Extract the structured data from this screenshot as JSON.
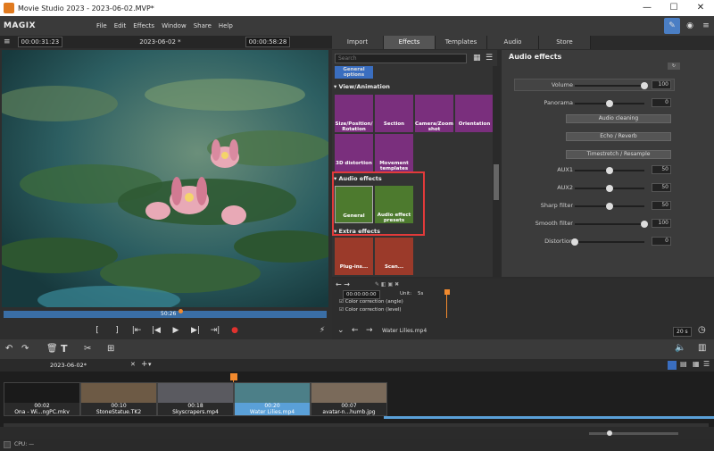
{
  "window": {
    "title": "Movie Studio 2023 - 2023-06-02.MVP*",
    "minimize": "—",
    "maximize": "☐",
    "close": "✕"
  },
  "menubar": {
    "logo": "MAGIX",
    "items": [
      "File",
      "Edit",
      "Effects",
      "Window",
      "Share",
      "Help"
    ]
  },
  "preview": {
    "timecode_left": "00:00:31:23",
    "project_name": "2023-06-02 *",
    "timecode_right": "00:00:58:28",
    "scrub_marker": "50:26"
  },
  "tabs": [
    {
      "label": "Import"
    },
    {
      "label": "Effects"
    },
    {
      "label": "Templates"
    },
    {
      "label": "Audio"
    },
    {
      "label": "Store"
    }
  ],
  "effects": {
    "search_placeholder": "Search",
    "top_item": "General options",
    "sections": [
      {
        "title": "View/Animation",
        "tiles": [
          "Size/Position/ Rotation",
          "Section",
          "Camera/Zoom shot",
          "Orientation",
          "3D distortion",
          "Movement templates"
        ]
      },
      {
        "title": "Audio effects",
        "tiles": [
          "General",
          "Audio effect presets"
        ]
      },
      {
        "title": "Extra effects",
        "tiles": [
          "Plug-ins...",
          "Scan..."
        ]
      }
    ]
  },
  "audio_panel": {
    "title": "Audio effects",
    "sliders": [
      {
        "label": "Volume",
        "value": "100"
      },
      {
        "label": "Panorama",
        "value": "0"
      },
      {
        "label": "AUX1",
        "value": "50"
      },
      {
        "label": "AUX2",
        "value": "50"
      },
      {
        "label": "Sharp filter",
        "value": "50"
      },
      {
        "label": "Smooth filter",
        "value": "100"
      },
      {
        "label": "Distortion",
        "value": "0"
      }
    ],
    "buttons": [
      "Audio cleaning",
      "Echo / Reverb",
      "Timestretch / Resample"
    ]
  },
  "keyframes": {
    "timecode": "00:00:00:00",
    "unit_label": "Unit:",
    "unit_value": "5s",
    "rows": [
      "Color correction (angle)",
      "Color correction (level)"
    ],
    "clip_label": "Water Lilies.mp4",
    "zoom": "20 s"
  },
  "timeline": {
    "project_tab": "2023-06-02*",
    "clips": [
      {
        "time": "00:02",
        "name": "Ona - Wi...ngPC.mkv"
      },
      {
        "time": "00:10",
        "name": "StoneStatue.TK2"
      },
      {
        "time": "00:18",
        "name": "Skyscrapers.mp4"
      },
      {
        "time": "00:20",
        "name": "Water Lilies.mp4"
      },
      {
        "time": "00:07",
        "name": "avatar-n...humb.jpg"
      }
    ]
  },
  "status": {
    "cpu": "CPU: —"
  }
}
